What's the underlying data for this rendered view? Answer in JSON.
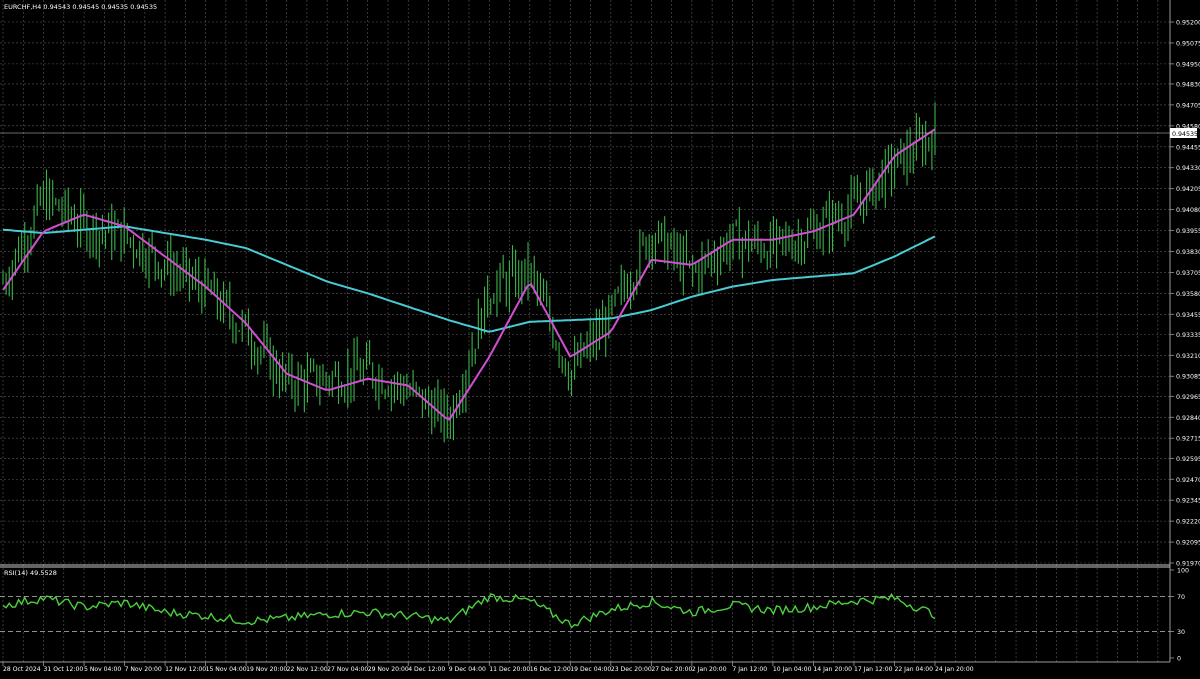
{
  "window": {
    "symbol_header": "EURCHF,H4  0.94543 0.94545 0.94535 0.94535"
  },
  "main_chart": {
    "current_price_label": "0.94535",
    "price_scale": [
      "0.95200",
      "0.95075",
      "0.94950",
      "0.94830",
      "0.94705",
      "0.94580",
      "0.94455",
      "0.94330",
      "0.94205",
      "0.94080",
      "0.93955",
      "0.93830",
      "0.93705",
      "0.93580",
      "0.93455",
      "0.93335",
      "0.93210",
      "0.93085",
      "0.92965",
      "0.92840",
      "0.92715",
      "0.92595",
      "0.92470",
      "0.92345",
      "0.92220",
      "0.92095",
      "0.91970"
    ],
    "colors": {
      "background": "#000000",
      "grid": "#5a5a5a",
      "candles": "#39b54a",
      "ma_fast": "#d24fd2",
      "ma_slow": "#49cbd6",
      "axis_text": "#ffffff"
    }
  },
  "rsi_panel": {
    "header": "RSI(14) 49.5528",
    "scale": [
      "100",
      "70",
      "30",
      "0"
    ],
    "levels": [
      70,
      30
    ],
    "color": "#4ad23c"
  },
  "time_axis": {
    "labels": [
      "28 Oct 2024",
      "31 Oct 12:00",
      "5 Nov 04:00",
      "7 Nov 20:00",
      "12 Nov 12:00",
      "15 Nov 04:00",
      "19 Nov 20:00",
      "22 Nov 12:00",
      "27 Nov 04:00",
      "29 Nov 20:00",
      "4 Dec 12:00",
      "9 Dec 04:00",
      "11 Dec 20:00",
      "16 Dec 12:00",
      "19 Dec 04:00",
      "23 Dec 20:00",
      "27 Dec 20:00",
      "2 Jan 20:00",
      "7 Jan 12:00",
      "10 Jan 04:00",
      "14 Jan 20:00",
      "17 Jan 12:00",
      "22 Jan 04:00",
      "24 Jan 20:00"
    ]
  },
  "chart_data": {
    "type": "line",
    "title": "EURCHF,H4",
    "ohlc_last": {
      "open": 0.94543,
      "high": 0.94545,
      "low": 0.94535,
      "close": 0.94535
    },
    "x": [
      "28 Oct 2024",
      "31 Oct 12:00",
      "5 Nov 04:00",
      "7 Nov 20:00",
      "12 Nov 12:00",
      "15 Nov 04:00",
      "19 Nov 20:00",
      "22 Nov 12:00",
      "27 Nov 04:00",
      "29 Nov 20:00",
      "4 Dec 12:00",
      "9 Dec 04:00",
      "11 Dec 20:00",
      "16 Dec 12:00",
      "19 Dec 04:00",
      "23 Dec 20:00",
      "27 Dec 20:00",
      "2 Jan 20:00",
      "7 Jan 12:00",
      "10 Jan 04:00",
      "14 Jan 20:00",
      "17 Jan 12:00",
      "22 Jan 04:00",
      "24 Jan 20:00"
    ],
    "series": [
      {
        "name": "close",
        "values": [
          0.9365,
          0.9415,
          0.9398,
          0.9392,
          0.9375,
          0.936,
          0.9335,
          0.9305,
          0.9307,
          0.9312,
          0.93,
          0.9282,
          0.936,
          0.937,
          0.931,
          0.9345,
          0.9395,
          0.937,
          0.939,
          0.9385,
          0.9395,
          0.941,
          0.9435,
          0.94535
        ]
      },
      {
        "name": "ma_fast",
        "values": [
          0.936,
          0.9395,
          0.9405,
          0.9398,
          0.938,
          0.9362,
          0.934,
          0.931,
          0.93,
          0.9307,
          0.9303,
          0.9282,
          0.932,
          0.9365,
          0.932,
          0.9335,
          0.9378,
          0.9375,
          0.939,
          0.939,
          0.9395,
          0.9405,
          0.944,
          0.9456
        ]
      },
      {
        "name": "ma_slow",
        "values": [
          0.9396,
          0.9394,
          0.9396,
          0.9398,
          0.9394,
          0.939,
          0.9385,
          0.9375,
          0.9365,
          0.9358,
          0.935,
          0.9342,
          0.9335,
          0.9341,
          0.9342,
          0.9343,
          0.9348,
          0.9356,
          0.9362,
          0.9366,
          0.9368,
          0.937,
          0.938,
          0.9392
        ]
      },
      {
        "name": "RSI(14)",
        "values": [
          60,
          68,
          58,
          63,
          52,
          48,
          42,
          45,
          50,
          52,
          48,
          42,
          70,
          65,
          38,
          55,
          64,
          52,
          60,
          54,
          58,
          65,
          68,
          49.5528
        ]
      }
    ],
    "ylim": [
      0.9197,
      0.952
    ],
    "rsi_ylim": [
      0,
      100
    ],
    "rsi_levels": [
      70,
      30
    ],
    "grid": true
  }
}
